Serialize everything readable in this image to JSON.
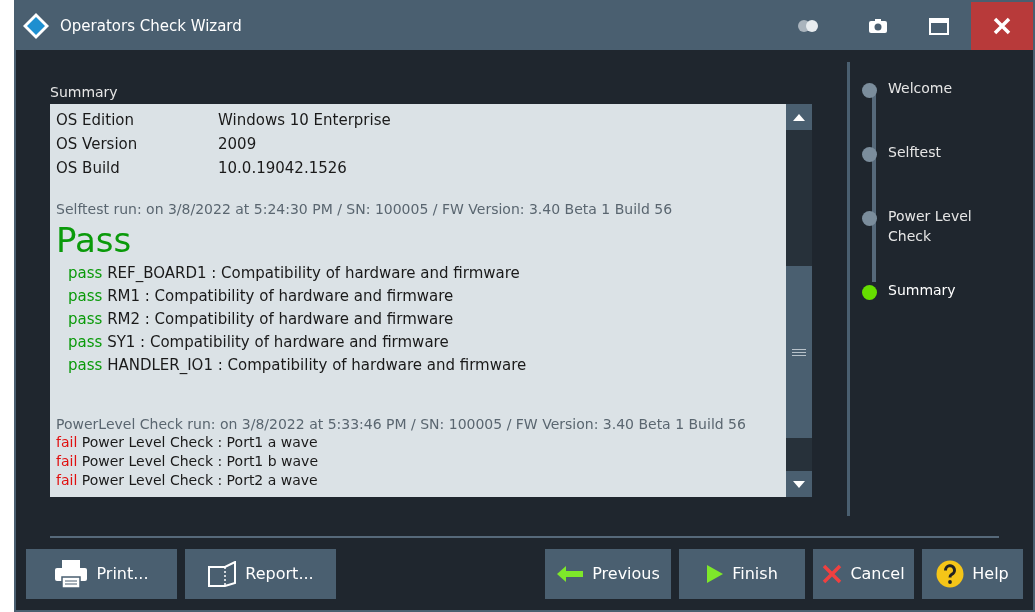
{
  "window": {
    "title": "Operators Check Wizard"
  },
  "summary": {
    "heading": "Summary",
    "info": [
      {
        "label": "OS Edition",
        "value": "Windows 10 Enterprise"
      },
      {
        "label": "OS Version",
        "value": "2009"
      },
      {
        "label": "OS Build",
        "value": "10.0.19042.1526"
      }
    ],
    "runs": [
      {
        "header": "Selftest run: on 3/8/2022 at 5:24:30 PM / SN: 100005 / FW Version: 3.40 Beta 1 Build 56",
        "verdict": "Pass",
        "results": [
          {
            "status": "pass",
            "text": "REF_BOARD1 : Compatibility of hardware and firmware"
          },
          {
            "status": "pass",
            "text": "RM1 : Compatibility of hardware and firmware"
          },
          {
            "status": "pass",
            "text": "RM2 : Compatibility of hardware and firmware"
          },
          {
            "status": "pass",
            "text": "SY1 : Compatibility of hardware and firmware"
          },
          {
            "status": "pass",
            "text": "HANDLER_IO1 : Compatibility of hardware and firmware"
          }
        ]
      },
      {
        "header": "PowerLevel Check run: on 3/8/2022 at 5:33:46 PM / SN: 100005 / FW Version: 3.40 Beta 1 Build 56",
        "results": [
          {
            "status": "fail",
            "text": "Power Level Check : Port1 a wave"
          },
          {
            "status": "fail",
            "text": "Power Level Check : Port1 b wave"
          },
          {
            "status": "fail",
            "text": "Power Level Check : Port2 a wave"
          }
        ]
      }
    ]
  },
  "steps": [
    {
      "label": "Welcome",
      "selected": false
    },
    {
      "label": "Selftest",
      "selected": false
    },
    {
      "label": "Power Level Check",
      "selected": false
    },
    {
      "label": "Summary",
      "selected": true
    }
  ],
  "buttons_left": [
    {
      "kind": "print",
      "label": "Print..."
    },
    {
      "kind": "report",
      "label": "Report..."
    }
  ],
  "buttons_right": [
    {
      "kind": "previous",
      "label": "Previous"
    },
    {
      "kind": "finish",
      "label": "Finish"
    },
    {
      "kind": "cancel",
      "label": "Cancel"
    },
    {
      "kind": "help",
      "label": "Help"
    }
  ]
}
